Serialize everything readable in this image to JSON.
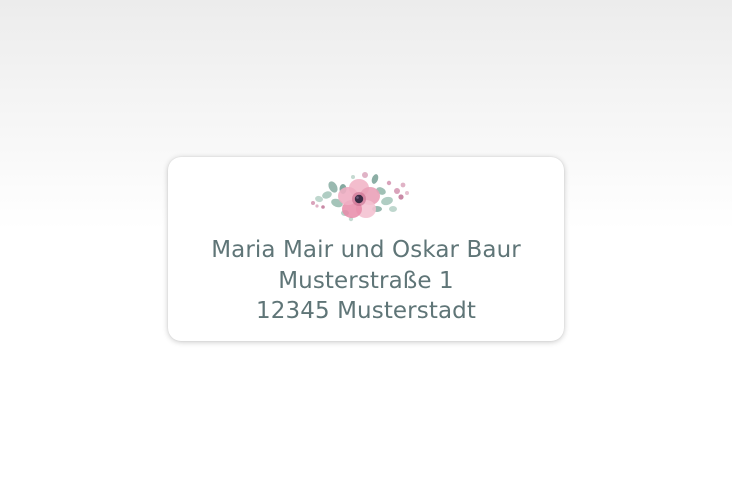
{
  "address_label": {
    "decoration_icon": "watercolor-flower-icon",
    "lines": [
      "Maria Mair und Oskar Baur",
      "Musterstraße 1",
      "12345 Musterstadt"
    ]
  },
  "colors": {
    "text": "#5f7577",
    "flower_pink": "#e88aa8",
    "flower_center": "#3a2b44",
    "leaf_green": "#8fb5a8",
    "berry_pink": "#d9a3bb"
  }
}
